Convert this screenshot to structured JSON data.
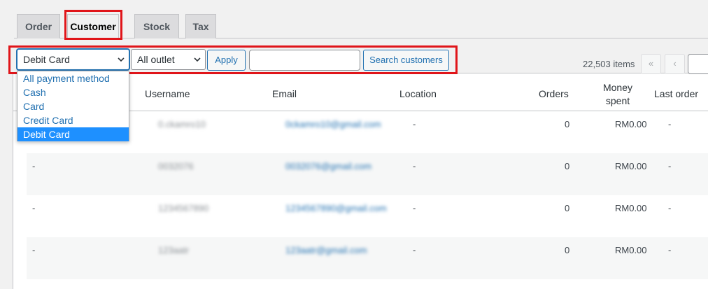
{
  "tabs": [
    {
      "label": "Order"
    },
    {
      "label": "Customer"
    },
    {
      "label": "Stock"
    },
    {
      "label": "Tax"
    }
  ],
  "filters": {
    "payment_selected": "Debit Card",
    "outlet_selected": "All outlet",
    "apply_label": "Apply",
    "search_value": "",
    "search_button_label": "Search customers"
  },
  "payment_options": [
    "All payment method",
    "Cash",
    "Card",
    "Credit Card",
    "Debit Card"
  ],
  "pagination": {
    "items_count": "22,503 items",
    "first_label": "«",
    "prev_label": "‹"
  },
  "table": {
    "headers": {
      "username": "Username",
      "email": "Email",
      "location": "Location",
      "orders": "Orders",
      "money_line1": "Money",
      "money_line2": "spent",
      "last_order": "Last order"
    },
    "rows": [
      {
        "name": "",
        "username": "0.ckamro10",
        "email": "0ckamro10@gmail.com",
        "location": "-",
        "orders": "0",
        "money": "RM0.00",
        "last_order": "-"
      },
      {
        "name": "-",
        "username": "0032076",
        "email": "0032076@gmail.com",
        "location": "-",
        "orders": "0",
        "money": "RM0.00",
        "last_order": "-"
      },
      {
        "name": "-",
        "username": "1234567890",
        "email": "1234567890@gmail.com",
        "location": "-",
        "orders": "0",
        "money": "RM0.00",
        "last_order": "-"
      },
      {
        "name": "-",
        "username": "123aatr",
        "email": "123aatr@gmail.com",
        "location": "-",
        "orders": "0",
        "money": "RM0.00",
        "last_order": "-"
      }
    ]
  },
  "colors": {
    "highlight": "#e0151a",
    "accent": "#2271b1",
    "dropdown_selected": "#1e90ff"
  },
  "icons": {
    "select_arrow": "chevron-down-icon"
  }
}
